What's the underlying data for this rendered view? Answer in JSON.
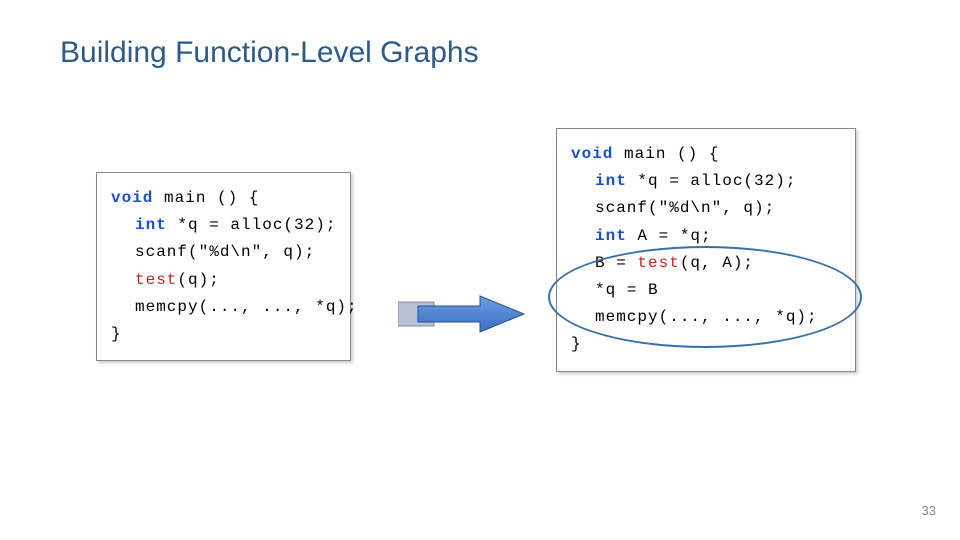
{
  "title": "Building Function-Level Graphs",
  "page_number": "33",
  "left_code": {
    "l1_kw": "void",
    "l1_rest": " main () {",
    "l2_kw": "int",
    "l2_rest": " *q = alloc(32);",
    "l3": "scanf(\"%d\\n\", q);",
    "l4_call": "test",
    "l4_rest": "(q);",
    "l5": "memcpy(..., ..., *q);",
    "l6": "}"
  },
  "right_code": {
    "l1_kw": "void",
    "l1_rest": " main () {",
    "l2_kw": "int",
    "l2_rest": " *q = alloc(32);",
    "l3": "scanf(\"%d\\n\", q);",
    "l4_kw": "int",
    "l4_rest": " A = *q;",
    "l5a": "B = ",
    "l5_call": "test",
    "l5b": "(q, A);",
    "l6": "*q = B",
    "l7": "memcpy(..., ..., *q);",
    "l8": "}"
  }
}
